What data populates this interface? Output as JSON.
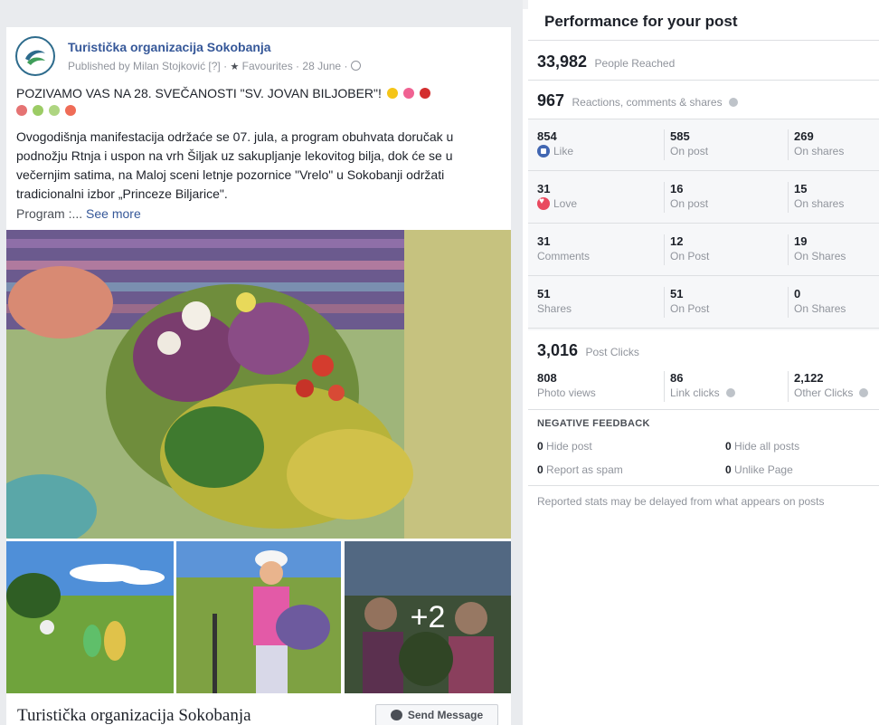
{
  "post": {
    "page_name": "Turistička organizacija Sokobanja",
    "published_by": "Published by Milan Stojković",
    "help_mark": "[?]",
    "favourites": "Favourites",
    "date": "28 June",
    "title": "POZIVAMO VAS NA 28. SVEČANOSTI \"SV. JOVAN BILJOBER\"!",
    "body": "Ovogodišnja manifestacija održaće se 07. jula, a program obuhvata doručak u podnožju Rtnja i uspon na vrh Šiljak uz sakupljanje lekovitog bilja, dok će se u večernjim satima, na Maloj sceni letnje pozornice \"Vrelo\" u Sokobanji održati tradicionalni izbor „Princeze Biljarice\".",
    "more_prefix": "Program :...",
    "see_more": "See more",
    "extra_photos": "+2",
    "footer_page_name": "Turistička organizacija Sokobanja",
    "send_message": "Send Message"
  },
  "performance": {
    "title": "Performance for your post",
    "reached": {
      "value": "33,982",
      "label": "People Reached"
    },
    "engagement": {
      "value": "967",
      "label": "Reactions, comments & shares"
    },
    "rows": [
      {
        "c1": {
          "num": "854",
          "label": "Like",
          "icon": "like-icon"
        },
        "c2": {
          "num": "585",
          "label": "On post"
        },
        "c3": {
          "num": "269",
          "label": "On shares"
        }
      },
      {
        "c1": {
          "num": "31",
          "label": "Love",
          "icon": "love-icon"
        },
        "c2": {
          "num": "16",
          "label": "On post"
        },
        "c3": {
          "num": "15",
          "label": "On shares"
        }
      },
      {
        "c1": {
          "num": "31",
          "label": "Comments"
        },
        "c2": {
          "num": "12",
          "label": "On Post"
        },
        "c3": {
          "num": "19",
          "label": "On Shares"
        }
      },
      {
        "c1": {
          "num": "51",
          "label": "Shares"
        },
        "c2": {
          "num": "51",
          "label": "On Post"
        },
        "c3": {
          "num": "0",
          "label": "On Shares"
        }
      }
    ],
    "clicks": {
      "value": "3,016",
      "label": "Post Clicks"
    },
    "click_breakdown": [
      {
        "num": "808",
        "label": "Photo views"
      },
      {
        "num": "86",
        "label": "Link clicks"
      },
      {
        "num": "2,122",
        "label": "Other Clicks"
      }
    ],
    "negative": {
      "title": "NEGATIVE FEEDBACK",
      "items": [
        {
          "num": "0",
          "label": "Hide post"
        },
        {
          "num": "0",
          "label": "Hide all posts"
        },
        {
          "num": "0",
          "label": "Report as spam"
        },
        {
          "num": "0",
          "label": "Unlike Page"
        }
      ]
    },
    "note": "Reported stats may be delayed from what appears on posts"
  },
  "colors": {
    "link": "#365899",
    "like": "#4267b2",
    "love": "#e9495f",
    "muted": "#90949c"
  }
}
